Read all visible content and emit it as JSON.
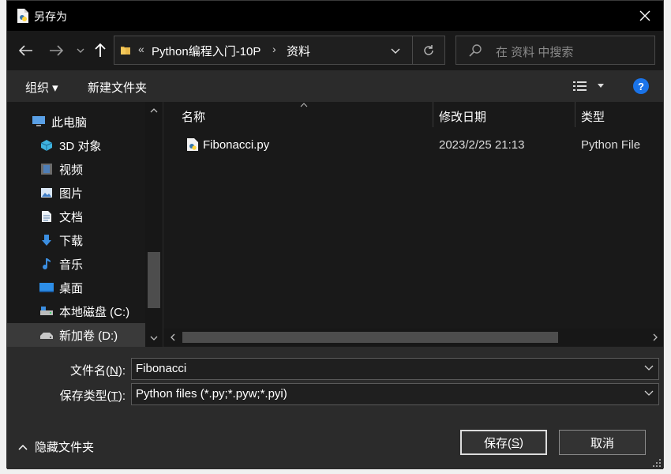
{
  "window": {
    "title": "另存为"
  },
  "address": {
    "overflow": "«",
    "crumbs": [
      "Python编程入门-10P",
      "资料"
    ],
    "sep": "›"
  },
  "search": {
    "placeholder": "在 资料 中搜索"
  },
  "toolbar": {
    "organize": "组织 ▾",
    "new_folder": "新建文件夹",
    "help": "?"
  },
  "sidebar": {
    "items": [
      {
        "label": "此电脑",
        "icon": "computer-icon"
      },
      {
        "label": "3D 对象",
        "icon": "cube-icon"
      },
      {
        "label": "视频",
        "icon": "video-icon"
      },
      {
        "label": "图片",
        "icon": "picture-icon"
      },
      {
        "label": "文档",
        "icon": "document-icon"
      },
      {
        "label": "下载",
        "icon": "download-icon"
      },
      {
        "label": "音乐",
        "icon": "music-icon"
      },
      {
        "label": "桌面",
        "icon": "desktop-icon"
      },
      {
        "label": "本地磁盘 (C:)",
        "icon": "drive-icon"
      },
      {
        "label": "新加卷 (D:)",
        "icon": "drive-icon"
      }
    ]
  },
  "columns": {
    "name": "名称",
    "modified": "修改日期",
    "type": "类型"
  },
  "files": [
    {
      "name": "Fibonacci.py",
      "modified": "2023/2/25 21:13",
      "type": "Python File"
    }
  ],
  "form": {
    "filename_label_pre": "文件名(",
    "filename_label_key": "N",
    "filename_label_post": "):",
    "filename_value": "Fibonacci",
    "filetype_label_pre": "保存类型(",
    "filetype_label_key": "T",
    "filetype_label_post": "):",
    "filetype_value": "Python files (*.py;*.pyw;*.pyi)"
  },
  "footer": {
    "hide_folders": "隐藏文件夹",
    "save_pre": "保存(",
    "save_key": "S",
    "save_post": ")",
    "cancel": "取消"
  },
  "colors": {
    "accent": "#1a73e8",
    "bg": "#191919",
    "toolbar": "#2b2b2b"
  }
}
